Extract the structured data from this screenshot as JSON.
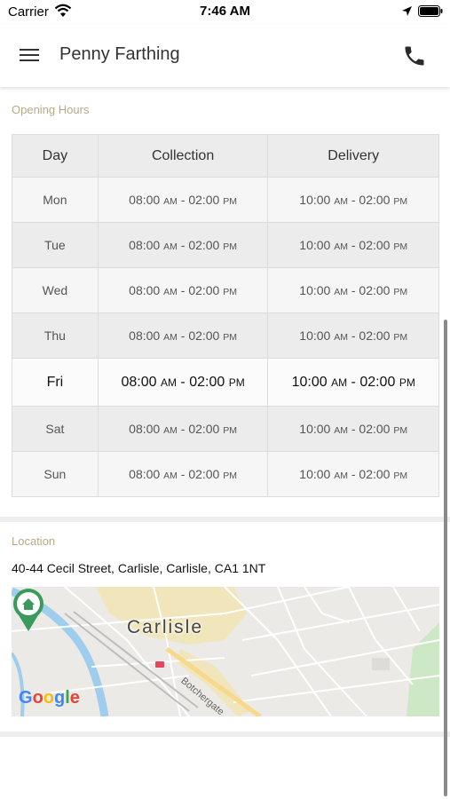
{
  "status_bar": {
    "carrier": "Carrier",
    "time": "7:46 AM"
  },
  "nav": {
    "title": "Penny Farthing"
  },
  "opening_hours": {
    "label": "Opening Hours",
    "headers": [
      "Day",
      "Collection",
      "Delivery"
    ],
    "rows": [
      {
        "day": "Mon",
        "collection_start": "08:00",
        "collection_start_ampm": "AM",
        "collection_end": "02:00",
        "collection_end_ampm": "PM",
        "delivery_start": "10:00",
        "delivery_start_ampm": "AM",
        "delivery_end": "02:00",
        "delivery_end_ampm": "PM"
      },
      {
        "day": "Tue",
        "collection_start": "08:00",
        "collection_start_ampm": "AM",
        "collection_end": "02:00",
        "collection_end_ampm": "PM",
        "delivery_start": "10:00",
        "delivery_start_ampm": "AM",
        "delivery_end": "02:00",
        "delivery_end_ampm": "PM"
      },
      {
        "day": "Wed",
        "collection_start": "08:00",
        "collection_start_ampm": "AM",
        "collection_end": "02:00",
        "collection_end_ampm": "PM",
        "delivery_start": "10:00",
        "delivery_start_ampm": "AM",
        "delivery_end": "02:00",
        "delivery_end_ampm": "PM"
      },
      {
        "day": "Thu",
        "collection_start": "08:00",
        "collection_start_ampm": "AM",
        "collection_end": "02:00",
        "collection_end_ampm": "PM",
        "delivery_start": "10:00",
        "delivery_start_ampm": "AM",
        "delivery_end": "02:00",
        "delivery_end_ampm": "PM"
      },
      {
        "day": "Fri",
        "collection_start": "08:00",
        "collection_start_ampm": "AM",
        "collection_end": "02:00",
        "collection_end_ampm": "PM",
        "delivery_start": "10:00",
        "delivery_start_ampm": "AM",
        "delivery_end": "02:00",
        "delivery_end_ampm": "PM"
      },
      {
        "day": "Sat",
        "collection_start": "08:00",
        "collection_start_ampm": "AM",
        "collection_end": "02:00",
        "collection_end_ampm": "PM",
        "delivery_start": "10:00",
        "delivery_start_ampm": "AM",
        "delivery_end": "02:00",
        "delivery_end_ampm": "PM"
      },
      {
        "day": "Sun",
        "collection_start": "08:00",
        "collection_start_ampm": "AM",
        "collection_end": "02:00",
        "collection_end_ampm": "PM",
        "delivery_start": "10:00",
        "delivery_start_ampm": "AM",
        "delivery_end": "02:00",
        "delivery_end_ampm": "PM"
      }
    ]
  },
  "location": {
    "label": "Location",
    "address": "40-44 Cecil Street, Carlisle, Carlisle, CA1 1NT",
    "map": {
      "city_label": "Carlisle",
      "street_label": "Botchergate",
      "logo": [
        "G",
        "o",
        "o",
        "g",
        "l",
        "e"
      ]
    }
  },
  "icons": {
    "menu": "hamburger-menu-icon",
    "phone": "phone-icon",
    "pin": "home-map-pin-icon"
  },
  "colors": {
    "section_label": "#b6a986",
    "pin": "#3a9a5b",
    "river": "#9fcdee"
  }
}
